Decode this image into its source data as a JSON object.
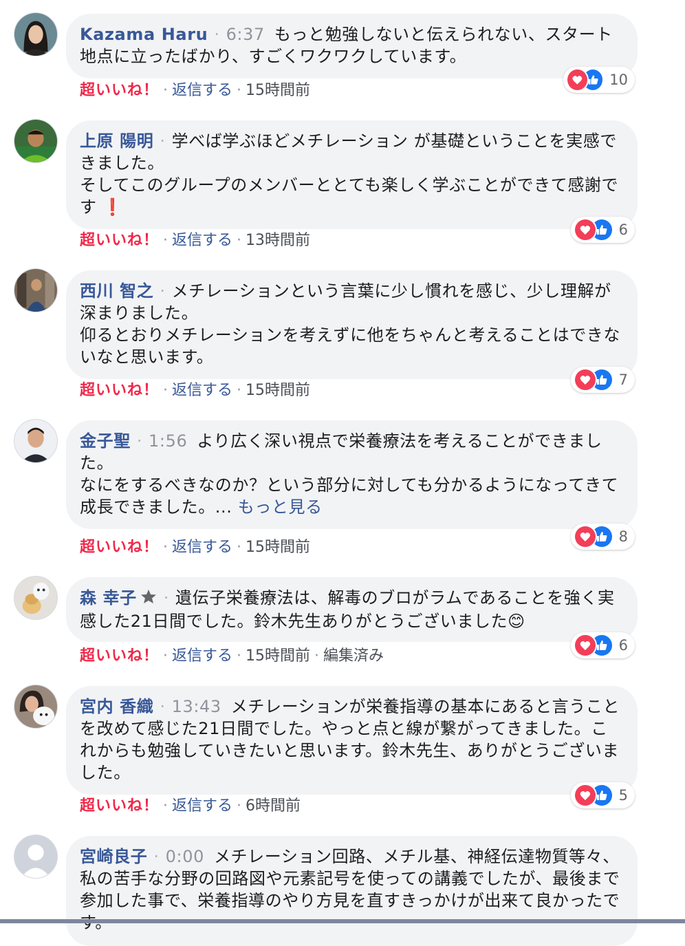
{
  "actions": {
    "super_like": "超いいね！",
    "separator": "·",
    "reply": "返信する"
  },
  "comments": [
    {
      "author": "Kazama Haru",
      "time": "6:37",
      "text": "もっと勉強しないと伝えられない、スタート地点に立ったばかり、すごくワクワクしています。",
      "reaction_count": "10",
      "ago": "15時間前"
    },
    {
      "author": "上原 陽明",
      "text": "学べば学ぶほどメチレーション が基礎ということを実感できました。\nそしてこのグループのメンバーととても楽しく学ぶことができて感謝です",
      "emoji": "❗",
      "reaction_count": "6",
      "ago": "13時間前"
    },
    {
      "author": "西川 智之",
      "text": "メチレーションという言葉に少し慣れを感じ、少し理解が深まりました。\n仰るとおりメチレーションを考えずに他をちゃんと考えることはできないなと思います。",
      "reaction_count": "7",
      "ago": "15時間前"
    },
    {
      "author": "金子聖",
      "time": "1:56",
      "text": "より広く深い視点で栄養療法を考えることができました。\nなにをするべきなのか？という部分に対しても分かるようになってきて成長できました。... ",
      "more": "もっと見る",
      "reaction_count": "8",
      "ago": "15時間前"
    },
    {
      "author": "森 幸子",
      "text": "遺伝子栄養療法は、解毒のブロがラムであることを強く実感した21日間でした。鈴木先生ありがとうございました",
      "emoji": "😊",
      "reaction_count": "6",
      "ago": "15時間前",
      "edited": "編集済み"
    },
    {
      "author": "宮内 香織",
      "time": "13:43",
      "text": "メチレーションが栄養指導の基本にあると言うことを改めて感じた21日間でした。やっと点と線が繋がってきました。これからも勉強していきたいと思います。鈴木先生、ありがとうございました。",
      "reaction_count": "5",
      "ago": "6時間前"
    },
    {
      "author": "宮崎良子",
      "time": "0:00",
      "text": "メチレーション回路、メチル基、神経伝達物質等々、私の苦手な分野の回路図や元素記号を使っての講義でしたが、最後まで参加した事で、栄養指導のやり方見を直すきっかけが出来て良かったです。"
    }
  ]
}
